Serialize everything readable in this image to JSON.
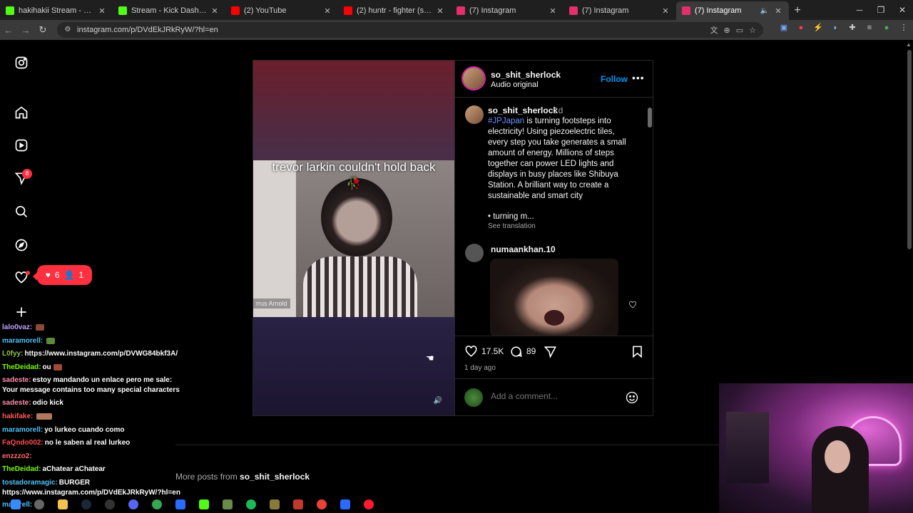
{
  "browser": {
    "tabs": [
      {
        "title": "hakihakii Stream - Watch Live o",
        "color": "#53fc18"
      },
      {
        "title": "Stream - Kick Dashboard",
        "color": "#53fc18"
      },
      {
        "title": "(2) YouTube",
        "color": "#ff0000"
      },
      {
        "title": "(2) huntr - fighter (soundcloud",
        "color": "#ff0000"
      },
      {
        "title": "(7) Instagram",
        "color": "#e1306c"
      },
      {
        "title": "(7) Instagram",
        "color": "#e1306c"
      },
      {
        "title": "(7) Instagram",
        "color": "#e1306c",
        "active": true
      }
    ],
    "new_tab": "+",
    "url": "instagram.com/p/DVdEkJRkRyW/?hl=en"
  },
  "sidebar": {
    "notification_count": "8",
    "activity_likes": "6",
    "activity_followers": "1"
  },
  "post": {
    "video_caption": "trevor larkin couldn't hold back 🥀",
    "video_name_tag": "rrus Arnold",
    "header": {
      "username": "so_shit_sherlock",
      "subtitle": "Audio original",
      "follow_label": "Follow",
      "more_label": "•••"
    },
    "caption": {
      "username": "so_shit_sherlock",
      "time": "1d",
      "hashtag": "#JPJapan",
      "text": " is turning footsteps into electricity! Using piezoelectric tiles, every step you take generates a small amount of energy. Millions of steps together can power LED lights and displays in busy places like Shibuya Station. A brilliant way to create a sustainable and smart city",
      "bullet": "•  turning m...",
      "see_translation": "See translation"
    },
    "comment": {
      "username": "numaankhan.10"
    },
    "likes": "17.5K",
    "comments_count": "89",
    "date": "1 day ago",
    "add_comment_placeholder": "Add a comment..."
  },
  "more_posts": {
    "prefix": "More posts from ",
    "username": "so_shit_sherlock"
  },
  "chat": [
    {
      "user": "lalo0vaz:",
      "text": "",
      "color": "#c6a0ff"
    },
    {
      "user": "maramorell:",
      "text": "",
      "color": "#4fc3f7"
    },
    {
      "user": "L0fyy:",
      "text": "https://www.instagram.com/p/DVWG84bkf3A/",
      "color": "#8bc34a"
    },
    {
      "user": "TheDeidad:",
      "text": "ou",
      "color": "#7cfc00"
    },
    {
      "user": "sadeste:",
      "text": "estoy mandando un enlace pero me sale:",
      "color": "#ff8fb1"
    },
    {
      "user": "",
      "text": "Your message contains too many special characters",
      "color": "#ffffff"
    },
    {
      "user": "sadeste:",
      "text": "odio kick",
      "color": "#ff8fb1"
    },
    {
      "user": "hakifake:",
      "text": "",
      "color": "#ff5a5a"
    },
    {
      "user": "maramorell:",
      "text": "yo lurkeo cuando como",
      "color": "#4fc3f7"
    },
    {
      "user": "FaQndo002:",
      "text": "no le saben al real lurkeo",
      "color": "#ff4d4d"
    },
    {
      "user": "enzzzo2:",
      "text": "",
      "color": "#ff6a6a"
    },
    {
      "user": "TheDeidad:",
      "text": "aChatear aChatear",
      "color": "#7cfc00"
    },
    {
      "user": "tostadoramagic:",
      "text": "BURGER",
      "color": "#4fc3f7"
    },
    {
      "user": "",
      "text": "https://www.instagram.com/p/DVdEkJRkRyW/?hl=en",
      "color": "#ffffff"
    },
    {
      "user": "maturell:",
      "text": "",
      "color": "#4fc3f7"
    }
  ]
}
